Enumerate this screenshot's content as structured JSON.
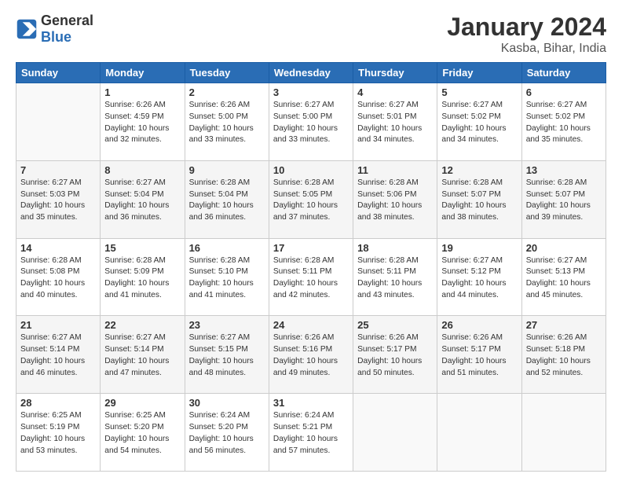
{
  "logo": {
    "general": "General",
    "blue": "Blue"
  },
  "header": {
    "month": "January 2024",
    "location": "Kasba, Bihar, India"
  },
  "days_of_week": [
    "Sunday",
    "Monday",
    "Tuesday",
    "Wednesday",
    "Thursday",
    "Friday",
    "Saturday"
  ],
  "weeks": [
    [
      {
        "day": "",
        "info": ""
      },
      {
        "day": "1",
        "info": "Sunrise: 6:26 AM\nSunset: 4:59 PM\nDaylight: 10 hours\nand 32 minutes."
      },
      {
        "day": "2",
        "info": "Sunrise: 6:26 AM\nSunset: 5:00 PM\nDaylight: 10 hours\nand 33 minutes."
      },
      {
        "day": "3",
        "info": "Sunrise: 6:27 AM\nSunset: 5:00 PM\nDaylight: 10 hours\nand 33 minutes."
      },
      {
        "day": "4",
        "info": "Sunrise: 6:27 AM\nSunset: 5:01 PM\nDaylight: 10 hours\nand 34 minutes."
      },
      {
        "day": "5",
        "info": "Sunrise: 6:27 AM\nSunset: 5:02 PM\nDaylight: 10 hours\nand 34 minutes."
      },
      {
        "day": "6",
        "info": "Sunrise: 6:27 AM\nSunset: 5:02 PM\nDaylight: 10 hours\nand 35 minutes."
      }
    ],
    [
      {
        "day": "7",
        "info": "Sunrise: 6:27 AM\nSunset: 5:03 PM\nDaylight: 10 hours\nand 35 minutes."
      },
      {
        "day": "8",
        "info": "Sunrise: 6:27 AM\nSunset: 5:04 PM\nDaylight: 10 hours\nand 36 minutes."
      },
      {
        "day": "9",
        "info": "Sunrise: 6:28 AM\nSunset: 5:04 PM\nDaylight: 10 hours\nand 36 minutes."
      },
      {
        "day": "10",
        "info": "Sunrise: 6:28 AM\nSunset: 5:05 PM\nDaylight: 10 hours\nand 37 minutes."
      },
      {
        "day": "11",
        "info": "Sunrise: 6:28 AM\nSunset: 5:06 PM\nDaylight: 10 hours\nand 38 minutes."
      },
      {
        "day": "12",
        "info": "Sunrise: 6:28 AM\nSunset: 5:07 PM\nDaylight: 10 hours\nand 38 minutes."
      },
      {
        "day": "13",
        "info": "Sunrise: 6:28 AM\nSunset: 5:07 PM\nDaylight: 10 hours\nand 39 minutes."
      }
    ],
    [
      {
        "day": "14",
        "info": "Sunrise: 6:28 AM\nSunset: 5:08 PM\nDaylight: 10 hours\nand 40 minutes."
      },
      {
        "day": "15",
        "info": "Sunrise: 6:28 AM\nSunset: 5:09 PM\nDaylight: 10 hours\nand 41 minutes."
      },
      {
        "day": "16",
        "info": "Sunrise: 6:28 AM\nSunset: 5:10 PM\nDaylight: 10 hours\nand 41 minutes."
      },
      {
        "day": "17",
        "info": "Sunrise: 6:28 AM\nSunset: 5:11 PM\nDaylight: 10 hours\nand 42 minutes."
      },
      {
        "day": "18",
        "info": "Sunrise: 6:28 AM\nSunset: 5:11 PM\nDaylight: 10 hours\nand 43 minutes."
      },
      {
        "day": "19",
        "info": "Sunrise: 6:27 AM\nSunset: 5:12 PM\nDaylight: 10 hours\nand 44 minutes."
      },
      {
        "day": "20",
        "info": "Sunrise: 6:27 AM\nSunset: 5:13 PM\nDaylight: 10 hours\nand 45 minutes."
      }
    ],
    [
      {
        "day": "21",
        "info": "Sunrise: 6:27 AM\nSunset: 5:14 PM\nDaylight: 10 hours\nand 46 minutes."
      },
      {
        "day": "22",
        "info": "Sunrise: 6:27 AM\nSunset: 5:14 PM\nDaylight: 10 hours\nand 47 minutes."
      },
      {
        "day": "23",
        "info": "Sunrise: 6:27 AM\nSunset: 5:15 PM\nDaylight: 10 hours\nand 48 minutes."
      },
      {
        "day": "24",
        "info": "Sunrise: 6:26 AM\nSunset: 5:16 PM\nDaylight: 10 hours\nand 49 minutes."
      },
      {
        "day": "25",
        "info": "Sunrise: 6:26 AM\nSunset: 5:17 PM\nDaylight: 10 hours\nand 50 minutes."
      },
      {
        "day": "26",
        "info": "Sunrise: 6:26 AM\nSunset: 5:17 PM\nDaylight: 10 hours\nand 51 minutes."
      },
      {
        "day": "27",
        "info": "Sunrise: 6:26 AM\nSunset: 5:18 PM\nDaylight: 10 hours\nand 52 minutes."
      }
    ],
    [
      {
        "day": "28",
        "info": "Sunrise: 6:25 AM\nSunset: 5:19 PM\nDaylight: 10 hours\nand 53 minutes."
      },
      {
        "day": "29",
        "info": "Sunrise: 6:25 AM\nSunset: 5:20 PM\nDaylight: 10 hours\nand 54 minutes."
      },
      {
        "day": "30",
        "info": "Sunrise: 6:24 AM\nSunset: 5:20 PM\nDaylight: 10 hours\nand 56 minutes."
      },
      {
        "day": "31",
        "info": "Sunrise: 6:24 AM\nSunset: 5:21 PM\nDaylight: 10 hours\nand 57 minutes."
      },
      {
        "day": "",
        "info": ""
      },
      {
        "day": "",
        "info": ""
      },
      {
        "day": "",
        "info": ""
      }
    ]
  ]
}
